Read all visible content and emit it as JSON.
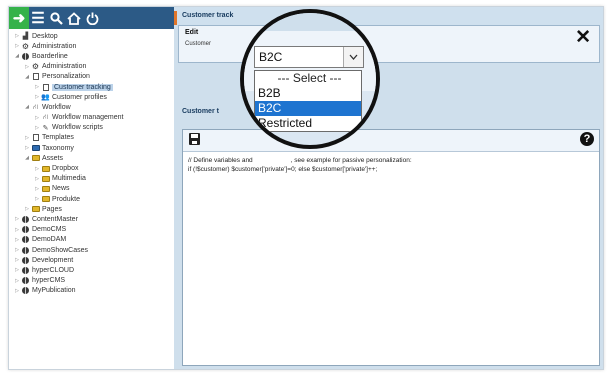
{
  "toolbar": {
    "icons": [
      "enter-icon",
      "menu-icon",
      "search-icon",
      "home-icon",
      "power-icon"
    ]
  },
  "tree": [
    {
      "label": "Desktop",
      "level": 0,
      "icon": "desktop"
    },
    {
      "label": "Administration",
      "level": 0,
      "icon": "gear"
    },
    {
      "label": "Boarderline",
      "level": 0,
      "icon": "globe",
      "expanded": true
    },
    {
      "label": "Administration",
      "level": 1,
      "icon": "gear"
    },
    {
      "label": "Personalization",
      "level": 1,
      "icon": "sheet",
      "expanded": true
    },
    {
      "label": "Customer tracking",
      "level": 2,
      "icon": "sheet",
      "selected": true
    },
    {
      "label": "Customer profiles",
      "level": 2,
      "icon": "people"
    },
    {
      "label": "Workflow",
      "level": 1,
      "icon": "workflow",
      "expanded": true
    },
    {
      "label": "Workflow management",
      "level": 2,
      "icon": "workflow"
    },
    {
      "label": "Workflow scripts",
      "level": 2,
      "icon": "pen"
    },
    {
      "label": "Templates",
      "level": 1,
      "icon": "sheet"
    },
    {
      "label": "Taxonomy",
      "level": 1,
      "icon": "folder-dark"
    },
    {
      "label": "Assets",
      "level": 1,
      "icon": "folder",
      "expanded": true
    },
    {
      "label": "Dropbox",
      "level": 2,
      "icon": "folder"
    },
    {
      "label": "Multimedia",
      "level": 2,
      "icon": "folder"
    },
    {
      "label": "News",
      "level": 2,
      "icon": "folder"
    },
    {
      "label": "Produkte",
      "level": 2,
      "icon": "folder"
    },
    {
      "label": "Pages",
      "level": 1,
      "icon": "folder"
    },
    {
      "label": "ContentMaster",
      "level": 0,
      "icon": "globe"
    },
    {
      "label": "DemoCMS",
      "level": 0,
      "icon": "globe"
    },
    {
      "label": "DemoDAM",
      "level": 0,
      "icon": "globe"
    },
    {
      "label": "DemoShowCases",
      "level": 0,
      "icon": "globe"
    },
    {
      "label": "Development",
      "level": 0,
      "icon": "globe"
    },
    {
      "label": "hyperCLOUD",
      "level": 0,
      "icon": "globe"
    },
    {
      "label": "hyperCMS",
      "level": 0,
      "icon": "globe"
    },
    {
      "label": "MyPublication",
      "level": 0,
      "icon": "globe"
    }
  ],
  "main": {
    "title": "Customer track",
    "edit_label": "Edit",
    "edit_sub": "Customer",
    "section_label": "Customer t",
    "code_line1": "// Define variables and                     , see example for passive personalization:",
    "code_line2": "if (!$customer) $customer['private']=0; else $customer['private']++;"
  },
  "dropdown": {
    "selected": "B2C",
    "options": [
      "--- Select ---",
      "B2B",
      "B2C",
      "Restricted"
    ],
    "active_index": 2
  }
}
